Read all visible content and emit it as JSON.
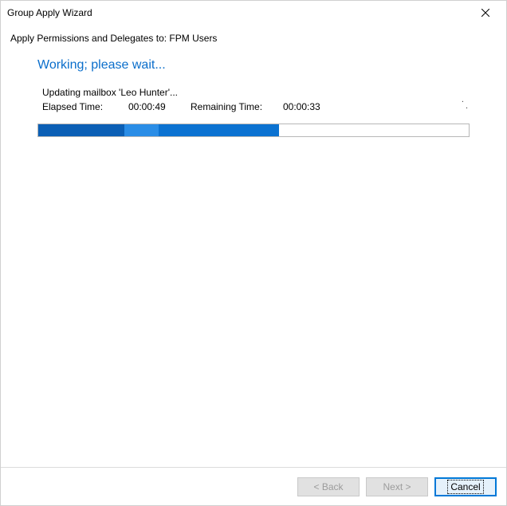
{
  "window": {
    "title": "Group Apply Wizard"
  },
  "subtitle": "Apply Permissions and Delegates to: FPM Users",
  "heading": "Working; please wait...",
  "status": "Updating mailbox 'Leo Hunter'...",
  "elapsed": {
    "label": "Elapsed Time:",
    "value": "00:00:49"
  },
  "remaining": {
    "label": "Remaining Time:",
    "value": "00:00:33"
  },
  "progress": {
    "percent": 56,
    "segments": [
      {
        "start": 0,
        "end": 20,
        "color": "#0b5fb5"
      },
      {
        "start": 20,
        "end": 28,
        "color": "#2a8de6"
      },
      {
        "start": 28,
        "end": 56,
        "color": "#0b72d1"
      }
    ]
  },
  "buttons": {
    "back": "< Back",
    "next": "Next >",
    "cancel": "Cancel"
  }
}
